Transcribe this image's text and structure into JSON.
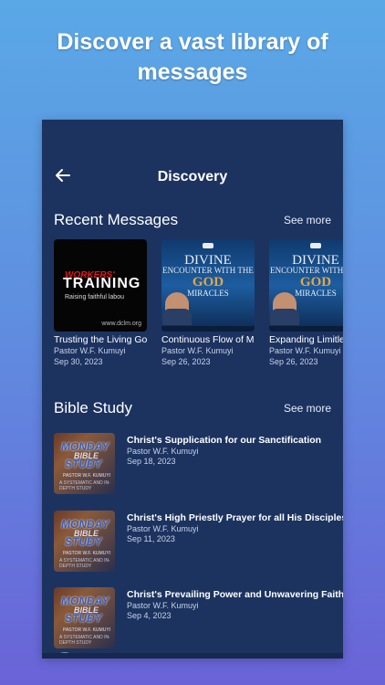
{
  "promo": {
    "headline": "Discover a vast library of messages"
  },
  "screen": {
    "title": "Discovery"
  },
  "recent": {
    "title": "Recent Messages",
    "see_more": "See more",
    "items": [
      {
        "title": "Trusting the Living God with the Whole",
        "author": "Pastor W.F. Kumuyi",
        "date": "Sep 30, 2023",
        "art": {
          "line1": "WORKERS'",
          "line2": "TRAINING",
          "line3": "Raising faithful labou",
          "url": "www.dclm.org"
        }
      },
      {
        "title": "Continuous Flow of Miracles Past Present",
        "author": "Pastor W.F. Kumuyi",
        "date": "Sep 26, 2023",
        "art": {
          "line1": "DIVINE",
          "line2": "ENCOUNTER WITH THE",
          "line3": "GOD",
          "line4": "MIRACLES"
        }
      },
      {
        "title": "Expanding Limitless Evangelistic Expansion",
        "author": "Pastor W.F. Kumuyi",
        "date": "Sep 26, 2023",
        "art": {
          "line1": "DIVINE",
          "line2": "ENCOUNTER WITH THE",
          "line3": "GOD",
          "line4": "MIRACLES"
        }
      }
    ]
  },
  "bible_study": {
    "title": "Bible Study",
    "see_more": "See more",
    "items": [
      {
        "title": "Christ's Supplication for our Sanctification",
        "author": "Pastor W.F. Kumuyi",
        "date": "Sep 18, 2023"
      },
      {
        "title": "Christ's High Priestly Prayer for all His Disciples",
        "author": "Pastor W.F. Kumuyi",
        "date": "Sep 11, 2023"
      },
      {
        "title": "Christ's Prevailing Power and Unwavering Faith",
        "author": "Pastor W.F. Kumuyi",
        "date": "Sep 4, 2023"
      }
    ],
    "art": {
      "line1": "MONDAY",
      "line2": "BIBLE",
      "line3": "STUDY",
      "line4": "PASTOR W.F. KUMUYI",
      "line5": "A SYSTEMATIC AND IN-DEPTH STUDY"
    }
  },
  "colors": {
    "screen_bg": "#1c3360",
    "gradient_top": "#5aa8e6",
    "gradient_bottom": "#6a63d8",
    "accent_gold": "#e0a64a"
  },
  "icons": {
    "back": "arrow-left-icon"
  }
}
